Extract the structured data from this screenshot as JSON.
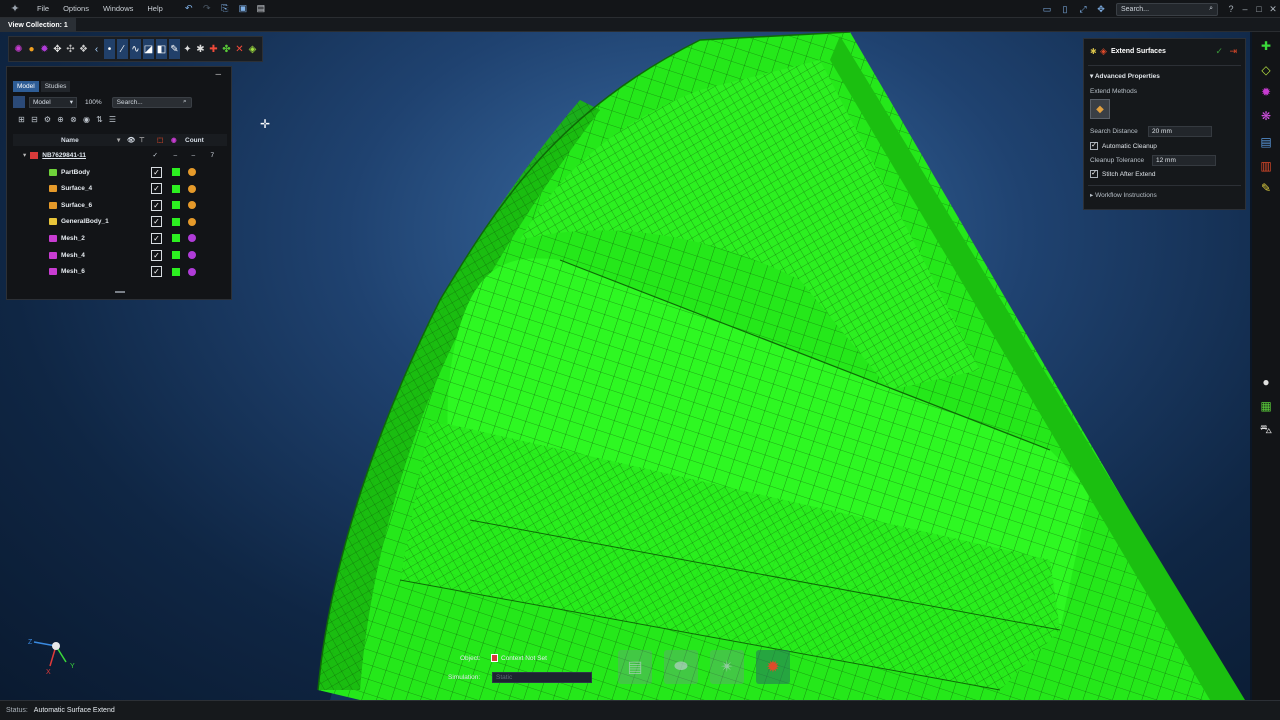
{
  "menu": {
    "items": [
      "File",
      "Options",
      "Windows",
      "Help"
    ],
    "search_placeholder": "Search..."
  },
  "view_collection": {
    "tab_label": "View Collection: 1"
  },
  "model_browser": {
    "tabs": [
      "Model",
      "Studies"
    ],
    "view_dropdown": "Model",
    "zoom": "100%",
    "search_placeholder": "Search...",
    "columns": {
      "name": "Name",
      "count": "Count"
    },
    "root": {
      "name": "NB7629841-11",
      "count": "7",
      "visible_check": "✓",
      "dash1": "–",
      "dash2": "–"
    },
    "items": [
      {
        "name": "PartBody",
        "icon_color": "#6fd23a",
        "type_color": "#e59a2a"
      },
      {
        "name": "Surface_4",
        "icon_color": "#e59a2a",
        "type_color": "#e59a2a"
      },
      {
        "name": "Surface_6",
        "icon_color": "#e59a2a",
        "type_color": "#e59a2a"
      },
      {
        "name": "GeneralBody_1",
        "icon_color": "#e8c53a",
        "type_color": "#e59a2a"
      },
      {
        "name": "Mesh_2",
        "icon_color": "#c83cd2",
        "type_color": "#b03cd8"
      },
      {
        "name": "Mesh_4",
        "icon_color": "#c83cd2",
        "type_color": "#b03cd8"
      },
      {
        "name": "Mesh_6",
        "icon_color": "#c83cd2",
        "type_color": "#b03cd8"
      }
    ]
  },
  "extend_panel": {
    "title": "Extend Surfaces",
    "advanced_header": "Advanced Properties",
    "extend_methods_label": "Extend Methods",
    "search_distance_label": "Search Distance",
    "search_distance_value": "20 mm",
    "automatic_cleanup_label": "Automatic Cleanup",
    "cleanup_tolerance_label": "Cleanup Tolerance",
    "cleanup_tolerance_value": "12 mm",
    "stitch_label": "Stitch After Extend",
    "workflow_label": "Workflow Instructions"
  },
  "bottom_panel": {
    "object_label": "Object:",
    "object_value": "Context Not Set",
    "simulation_label": "Simulation:",
    "simulation_value": "Static"
  },
  "status": {
    "label": "Status:",
    "value": "Automatic Surface Extend"
  },
  "colors": {
    "mesh_green": "#2af019",
    "accent_blue": "#2e5d96"
  }
}
